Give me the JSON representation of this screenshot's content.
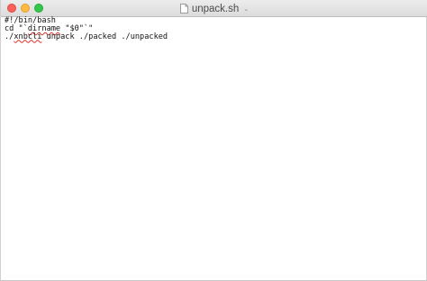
{
  "window": {
    "title": "unpack.sh",
    "title_chevron": "⌄",
    "file_icon": "document-icon",
    "traffic_lights": {
      "close_color": "#fc605c",
      "minimize_color": "#fdbc40",
      "zoom_color": "#34c84a"
    }
  },
  "editor": {
    "lines": [
      {
        "segments": [
          {
            "text": "#!/bin/bash",
            "misspelled": false
          }
        ]
      },
      {
        "segments": [
          {
            "text": "cd \"`",
            "misspelled": false
          },
          {
            "text": "dirname",
            "misspelled": true
          },
          {
            "text": " \"$0\"`\"",
            "misspelled": false
          }
        ]
      },
      {
        "segments": [
          {
            "text": "./",
            "misspelled": false
          },
          {
            "text": "xnbcli",
            "misspelled": true
          },
          {
            "text": " unpack ./packed ./unpacked",
            "misspelled": false
          }
        ]
      }
    ]
  }
}
